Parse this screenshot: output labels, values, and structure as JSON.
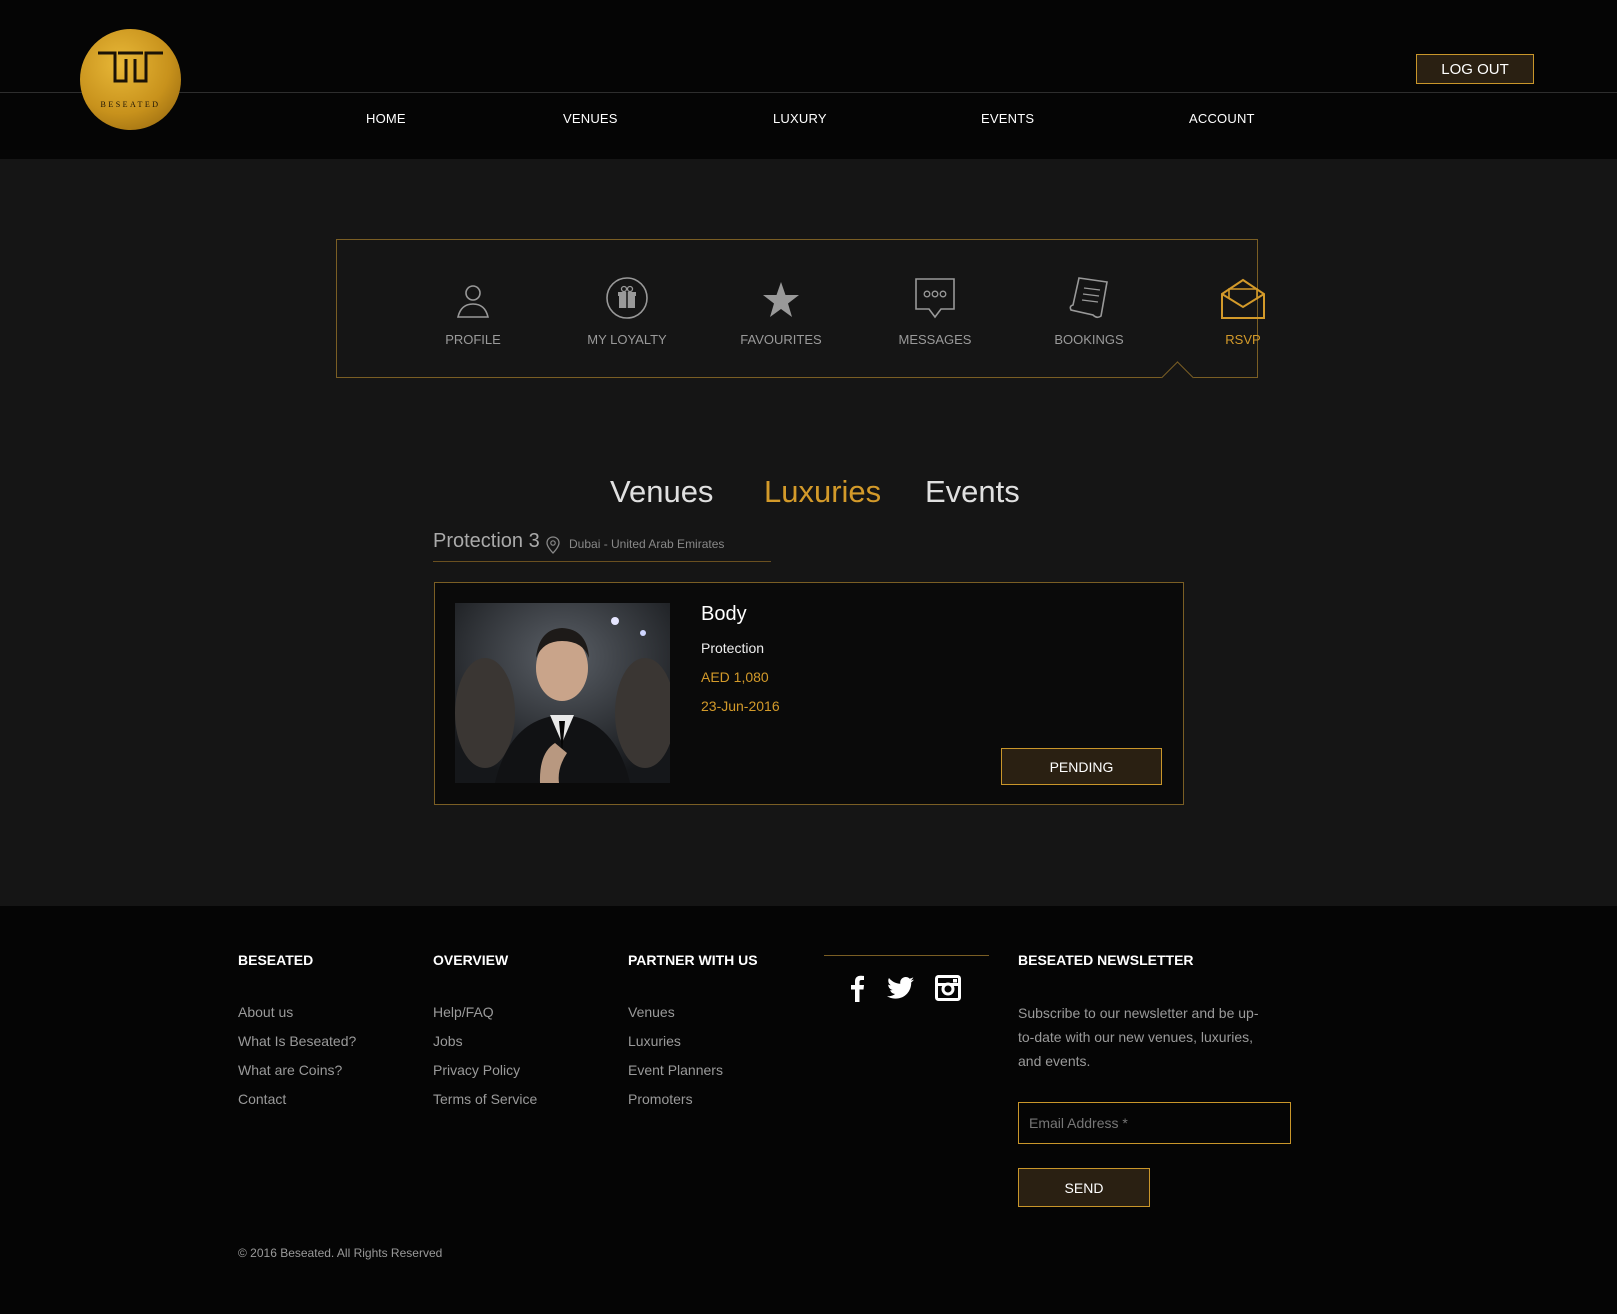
{
  "header": {
    "logo_text": "BESEATED",
    "logout_label": "LOG OUT",
    "nav": [
      "HOME",
      "VENUES",
      "LUXURY",
      "EVENTS",
      "ACCOUNT"
    ]
  },
  "account_menu": {
    "items": [
      {
        "label": "PROFILE",
        "icon": "user-icon"
      },
      {
        "label": "MY LOYALTY",
        "icon": "gift-icon"
      },
      {
        "label": "FAVOURITES",
        "icon": "star-icon"
      },
      {
        "label": "MESSAGES",
        "icon": "chat-icon"
      },
      {
        "label": "BOOKINGS",
        "icon": "receipt-icon"
      },
      {
        "label": "RSVP",
        "icon": "envelope-icon"
      }
    ],
    "active": "RSVP"
  },
  "category_tabs": [
    "Venues",
    "Luxuries",
    "Events"
  ],
  "active_category": "Luxuries",
  "item": {
    "title": "Protection 3",
    "location": "Dubai - United Arab Emirates"
  },
  "card": {
    "name": "Body",
    "category": "Protection",
    "price": "AED 1,080",
    "date": "23-Jun-2016",
    "status": "PENDING"
  },
  "footer": {
    "col1": {
      "title": "BESEATED",
      "links": [
        "About us",
        "What Is Beseated?",
        "What are Coins?",
        "Contact"
      ]
    },
    "col2": {
      "title": "OVERVIEW",
      "links": [
        "Help/FAQ",
        "Jobs",
        "Privacy Policy",
        "Terms of Service"
      ]
    },
    "col3": {
      "title": "PARTNER WITH US",
      "links": [
        "Venues",
        "Luxuries",
        "Event Planners",
        "Promoters"
      ]
    },
    "social": [
      "facebook-icon",
      "twitter-icon",
      "instagram-icon"
    ],
    "newsletter": {
      "title": "BESEATED NEWSLETTER",
      "text": "Subscribe to our newsletter and be up-to-date with our new venues, luxuries, and events.",
      "placeholder": "Email Address *",
      "send_label": "SEND"
    },
    "copyright": "© 2016 Beseated. All Rights Reserved"
  },
  "colors": {
    "accent": "#d39a2a",
    "background": "#151515",
    "header": "#050505"
  }
}
